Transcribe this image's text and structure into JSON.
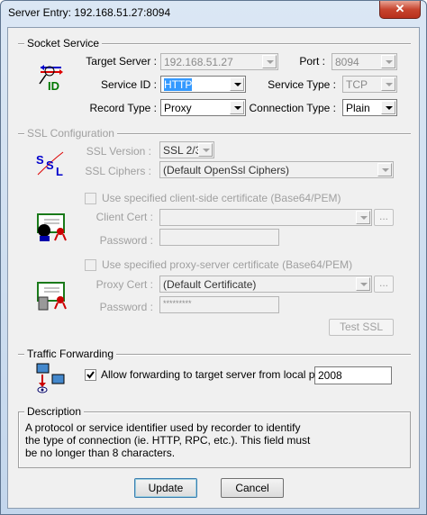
{
  "window": {
    "title": "Server Entry: 192.168.51.27:8094",
    "close": "✕"
  },
  "socket": {
    "group": "Socket Service",
    "target_label": "Target Server :",
    "target_value": "192.168.51.27",
    "port_label": "Port :",
    "port_value": "8094",
    "service_id_label": "Service ID :",
    "service_id_value": "HTTP",
    "service_type_label": "Service Type :",
    "service_type_value": "TCP",
    "record_type_label": "Record Type :",
    "record_type_value": "Proxy",
    "connection_type_label": "Connection Type :",
    "connection_type_value": "Plain",
    "icon_text": "ID"
  },
  "ssl": {
    "group": "SSL Configuration",
    "version_label": "SSL Version :",
    "version_value": "SSL 2/3",
    "ciphers_label": "SSL Ciphers :",
    "ciphers_value": "(Default OpenSsl Ciphers)",
    "client_check": "Use specified client-side certificate (Base64/PEM)",
    "client_cert_label": "Client Cert :",
    "client_cert_value": "",
    "password_label": "Password :",
    "client_password": "",
    "browse": "...",
    "proxy_check": "Use specified proxy-server certificate (Base64/PEM)",
    "proxy_cert_label": "Proxy Cert :",
    "proxy_cert_value": "(Default Certificate)",
    "proxy_password": "*********",
    "test_button": "Test SSL"
  },
  "traffic": {
    "group": "Traffic Forwarding",
    "check_label": "Allow forwarding to target server from local port :",
    "port_value": "2008",
    "checked": true
  },
  "description": {
    "group": "Description",
    "lines": [
      "A protocol or service identifier used by recorder to identify",
      "the type of connection (ie. HTTP, RPC, etc.).  This field must",
      "be no longer than 8 characters."
    ]
  },
  "buttons": {
    "update": "Update",
    "cancel": "Cancel"
  }
}
